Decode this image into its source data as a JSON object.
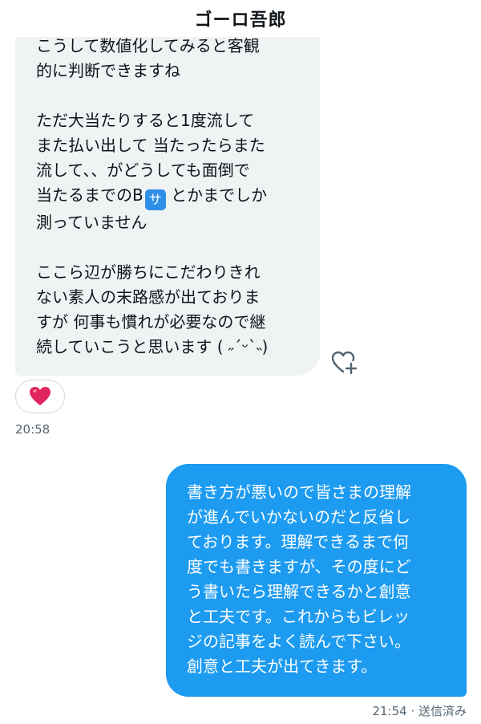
{
  "header": {
    "title": "ゴーロ吾郎"
  },
  "received_message": {
    "lines": [
      "こうして数値化してみると客観",
      "的に判断できますね",
      "",
      "ただ大当たりすると1度流して",
      "また払い出して 当たったらまた",
      "流して、、がどうしても面倒で"
    ],
    "line_b_prefix": "当たるまでのB",
    "emoji_label": "サ",
    "line_b_suffix": "とかまでしか",
    "lines_after": [
      "測っていません",
      "",
      "ここら辺が勝ちにこだわりきれ",
      "ない素人の末路感が出ておりま",
      "すが 何事も慣れが必要なので継",
      "続していこうと思います ( ˶ˊᵕˋ˵)"
    ],
    "time": "20:58",
    "reaction_icon": "heart-icon"
  },
  "sent_message": {
    "lines": [
      "書き方が悪いので皆さまの理解",
      "が進んでいかないのだと反省し",
      "ております。理解できるまで何",
      "度でも書きますが、その度にど",
      "う書いたら理解できるかと創意",
      "と工夫です。これからもビレッ",
      "ジの記事をよく読んで下さい。",
      "創意と工夫が出てきます。"
    ],
    "time_status": "21:54 · 送信済み"
  },
  "colors": {
    "sent_bubble": "#1d9bf0",
    "received_bubble": "#eff3f4",
    "reaction_heart": "#e0245e"
  }
}
